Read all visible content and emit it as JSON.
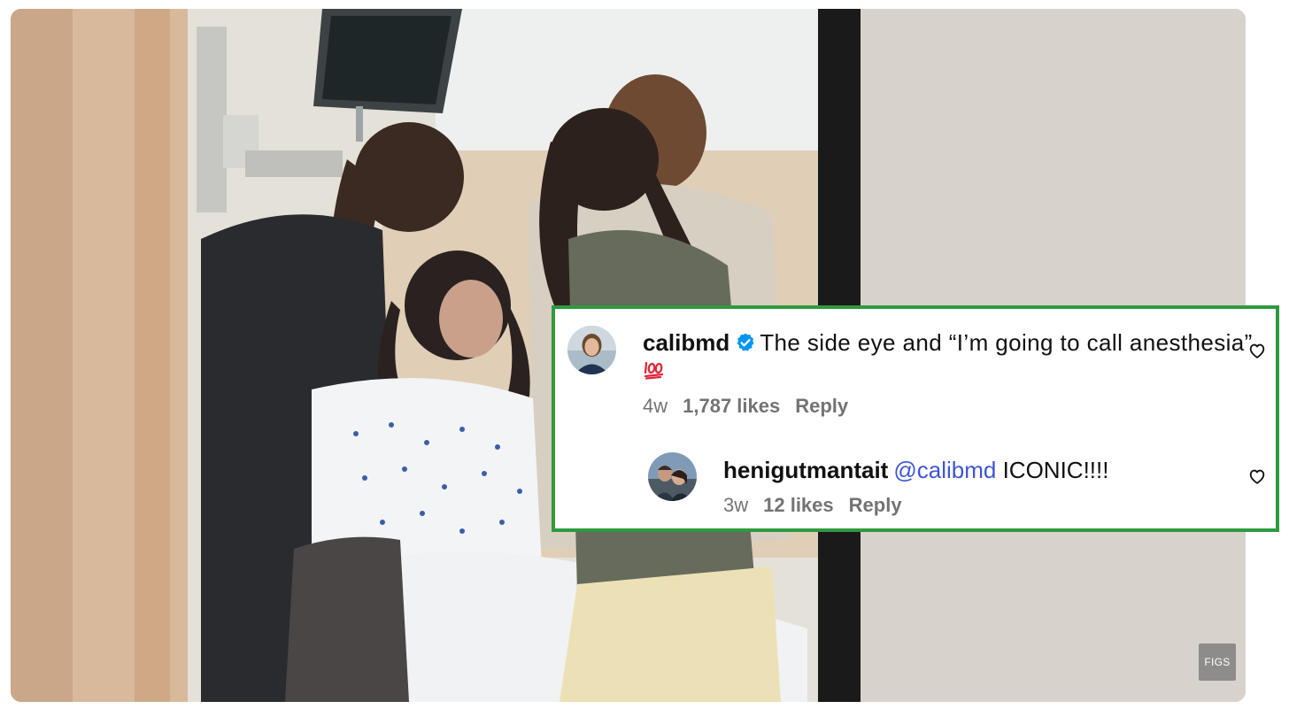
{
  "watermark": {
    "label": "FIGS",
    "icon": "figs-logo-icon"
  },
  "comments": [
    {
      "username": "calibmd",
      "verified": true,
      "text": "The side eye and “I’m going to call anesthesia”",
      "emoji": "hundred-points-emoji",
      "age": "4w",
      "likes": "1,787 likes",
      "reply_label": "Reply"
    },
    {
      "username": "henigutmantait",
      "mention": "@calibmd",
      "text": "ICONIC!!!!",
      "age": "3w",
      "likes": "12 likes",
      "reply_label": "Reply"
    }
  ],
  "colors": {
    "highlight_border": "#2f9a3f",
    "mention": "#3f55d4",
    "verified_badge": "#0095f6",
    "meta_text": "#737373"
  }
}
